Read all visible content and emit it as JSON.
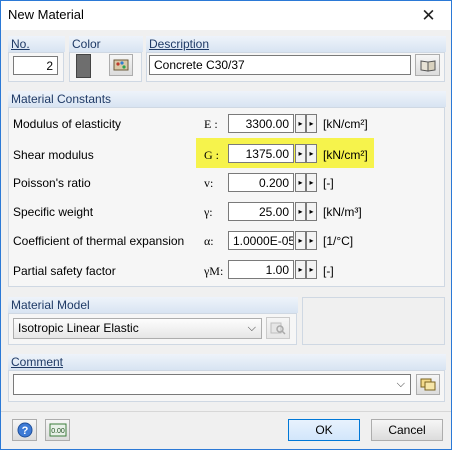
{
  "window": {
    "title": "New Material",
    "close_icon": "close-icon"
  },
  "header": {
    "no_label": "No.",
    "no_value": "2",
    "color_label": "Color",
    "description_label": "Description",
    "description_value": "Concrete C30/37"
  },
  "constants": {
    "section_title": "Material Constants",
    "rows": [
      {
        "label": "Modulus of elasticity",
        "symbol": "E :",
        "value": "3300.00",
        "unit": "[kN/cm²]"
      },
      {
        "label": "Shear modulus",
        "symbol": "G :",
        "value": "1375.00",
        "unit": "[kN/cm²]"
      },
      {
        "label": "Poisson's ratio",
        "symbol": "v:",
        "value": "0.200",
        "unit": "[-]"
      },
      {
        "label": "Specific weight",
        "symbol": "γ:",
        "value": "25.00",
        "unit": "[kN/m³]"
      },
      {
        "label": "Coefficient of thermal expansion",
        "symbol": "α:",
        "value": "1.0000E-05",
        "unit": "[1/°C]"
      },
      {
        "label": "Partial safety factor",
        "symbol": "γM:",
        "value": "1.00",
        "unit": "[-]"
      }
    ]
  },
  "model": {
    "section_title": "Material Model",
    "selected": "Isotropic Linear Elastic"
  },
  "comment": {
    "section_title": "Comment",
    "value": ""
  },
  "buttons": {
    "ok": "OK",
    "cancel": "Cancel"
  },
  "colors": {
    "material_swatch": "#6e6e6e",
    "highlight": "#f6f34c"
  }
}
